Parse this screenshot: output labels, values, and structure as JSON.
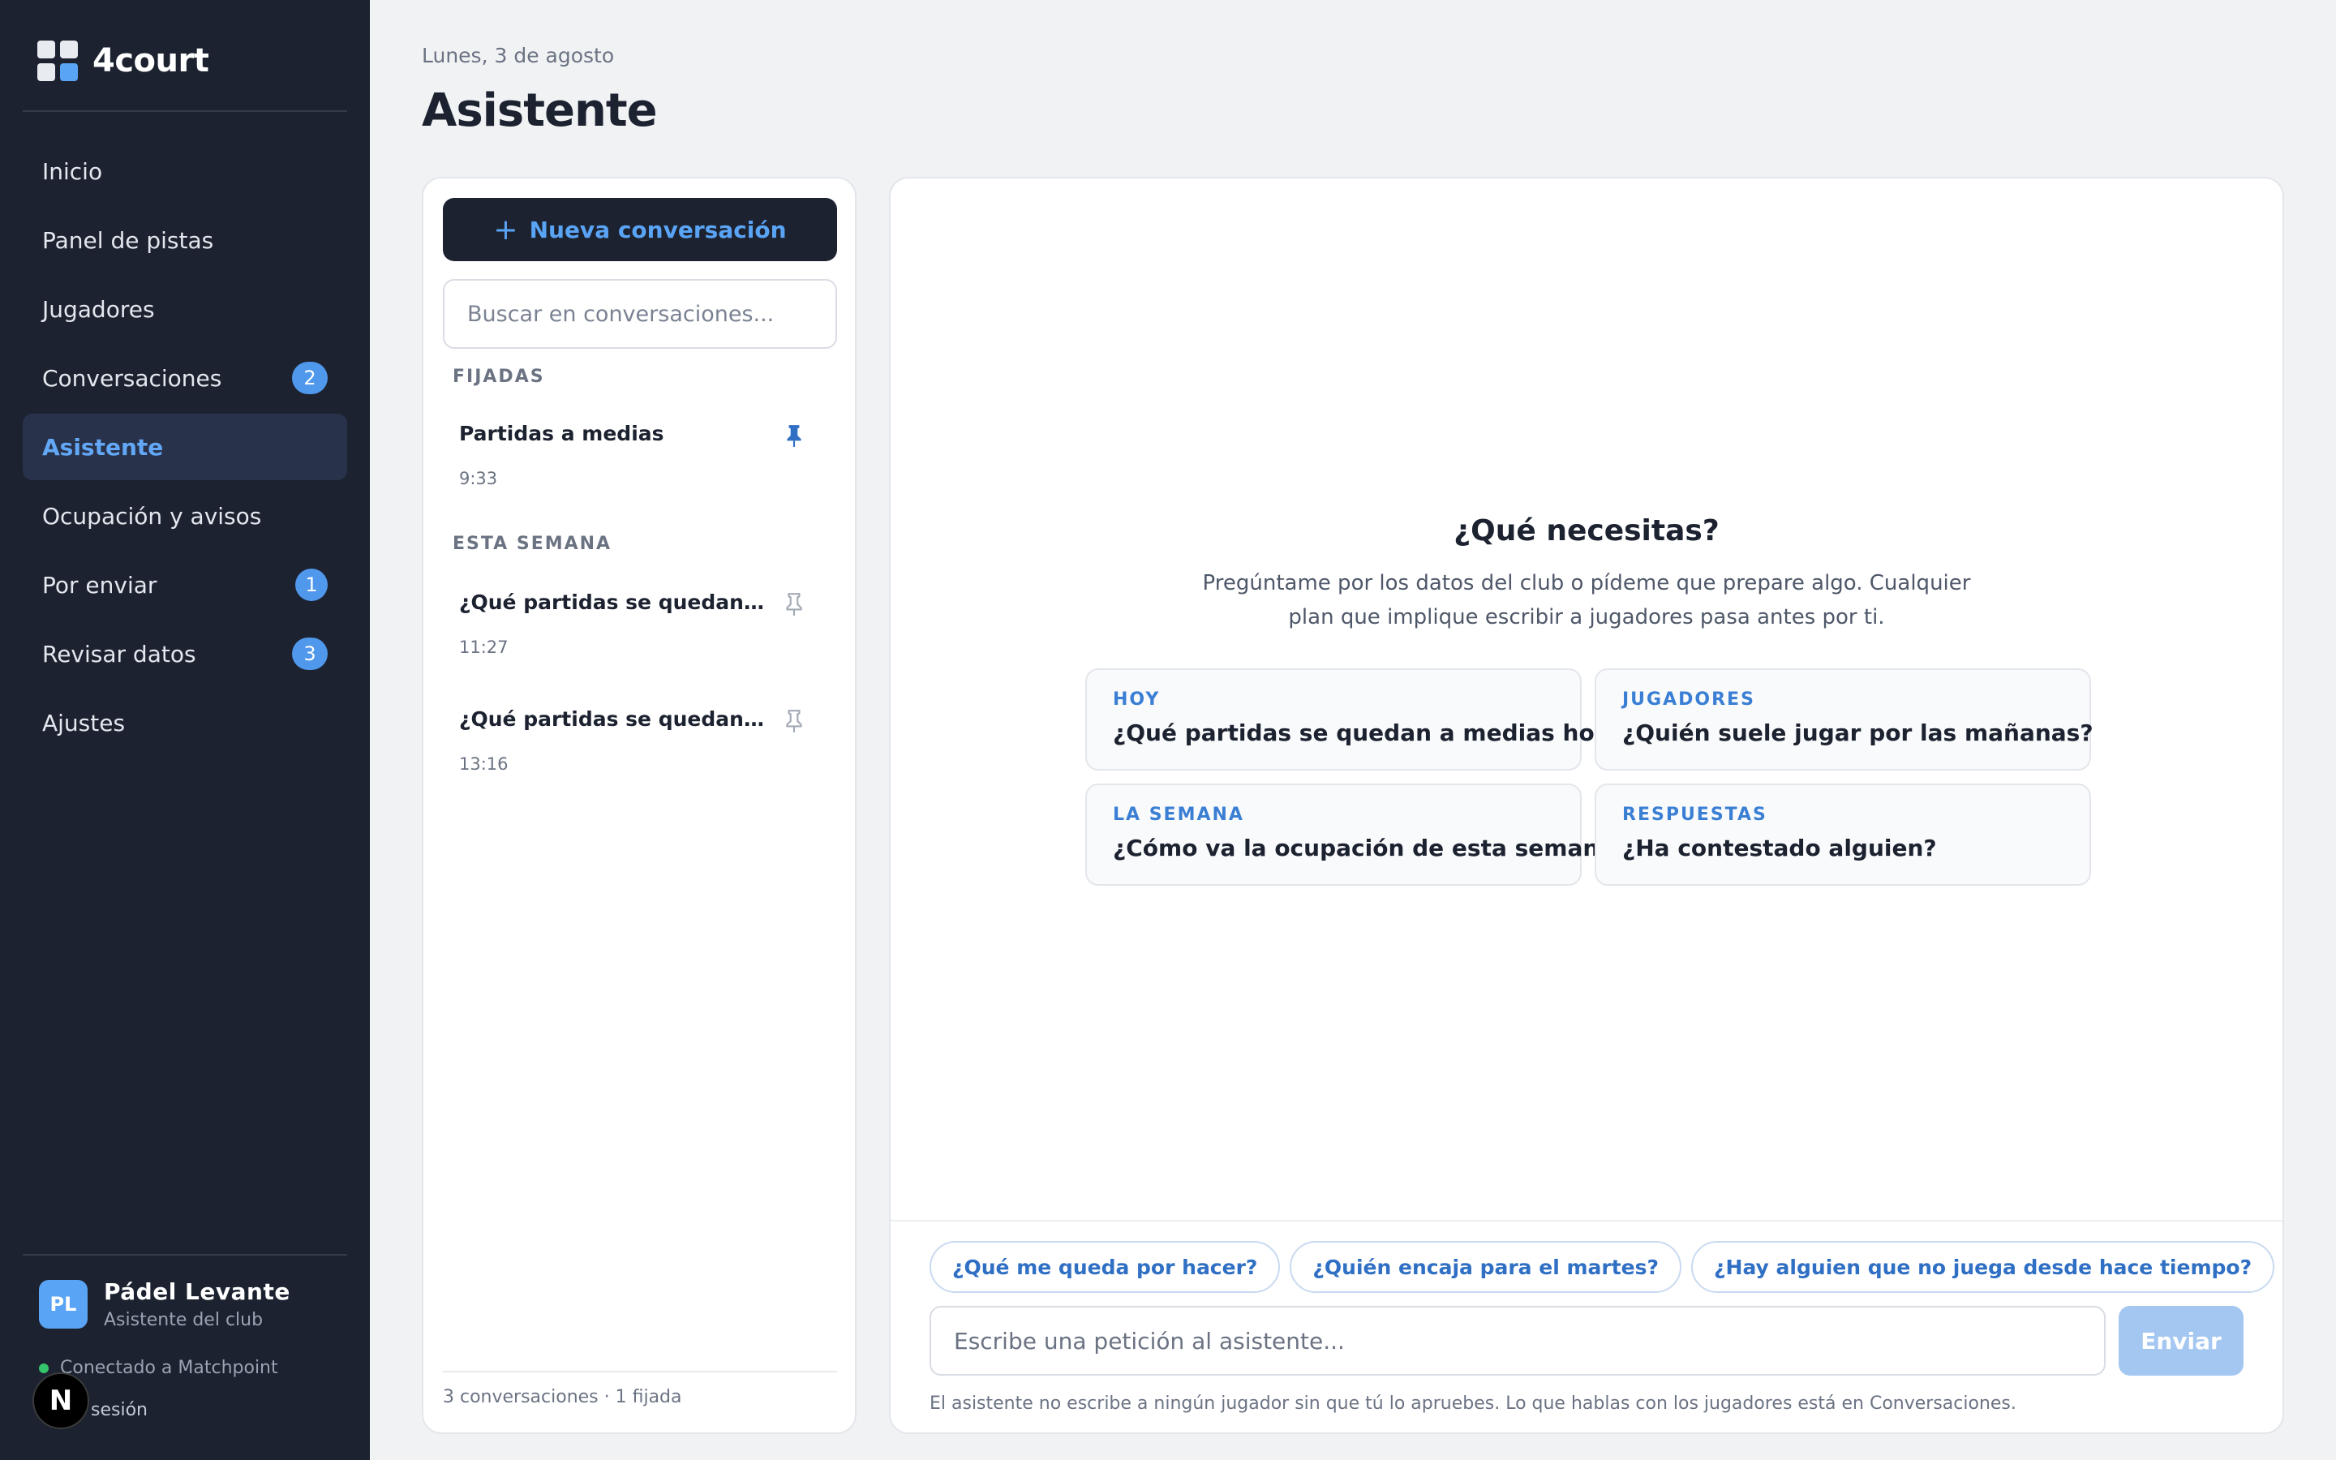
{
  "brand": {
    "name": "4court"
  },
  "sidebar": {
    "items": [
      {
        "label": "Inicio",
        "badge": null
      },
      {
        "label": "Panel de pistas",
        "badge": null
      },
      {
        "label": "Jugadores",
        "badge": null
      },
      {
        "label": "Conversaciones",
        "badge": "2"
      },
      {
        "label": "Asistente",
        "badge": null,
        "active": true
      },
      {
        "label": "Ocupación y avisos",
        "badge": null
      },
      {
        "label": "Por enviar",
        "badge": "1"
      },
      {
        "label": "Revisar datos",
        "badge": "3"
      },
      {
        "label": "Ajustes",
        "badge": null
      }
    ],
    "club": {
      "initials": "PL",
      "name": "Pádel Levante",
      "subtitle": "Asistente del club"
    },
    "connection": "Conectado a Matchpoint",
    "logout": "sesión",
    "dev_badge": "N"
  },
  "header": {
    "date": "Lunes, 3 de agosto",
    "title": "Asistente"
  },
  "conversations": {
    "new_label": "Nueva conversación",
    "search_placeholder": "Buscar en conversaciones...",
    "pinned_label": "FIJADAS",
    "week_label": "ESTA SEMANA",
    "pinned": [
      {
        "title": "Partidas a medias",
        "time": "9:33"
      }
    ],
    "week": [
      {
        "title": "¿Qué partidas se quedan a medias hoy?",
        "time": "11:27"
      },
      {
        "title": "¿Qué partidas se quedan a medias hoy?",
        "time": "13:16"
      }
    ],
    "footer": "3 conversaciones · 1 fijada"
  },
  "chat": {
    "empty_title": "¿Qué necesitas?",
    "empty_desc": "Pregúntame por los datos del club o pídeme que prepare algo. Cualquier plan que implique escribir a jugadores pasa antes por ti.",
    "cards": [
      {
        "kicker": "HOY",
        "text": "¿Qué partidas se quedan a medias hoy?"
      },
      {
        "kicker": "JUGADORES",
        "text": "¿Quién suele jugar por las mañanas?"
      },
      {
        "kicker": "LA SEMANA",
        "text": "¿Cómo va la ocupación de esta semana?"
      },
      {
        "kicker": "RESPUESTAS",
        "text": "¿Ha contestado alguien?"
      }
    ],
    "chips": [
      "¿Qué me queda por hacer?",
      "¿Quién encaja para el martes?",
      "¿Hay alguien que no juega desde hace tiempo?"
    ],
    "input_placeholder": "Escribe una petición al asistente...",
    "send_label": "Enviar",
    "disclaimer": "El asistente no escribe a ningún jugador sin que tú lo apruebes. Lo que hablas con los jugadores está en Conversaciones."
  },
  "colors": {
    "sidebar_bg": "#1c2230",
    "accent": "#5aa4f5",
    "badge": "#4f98ec",
    "send_disabled": "#a4c7f1"
  }
}
